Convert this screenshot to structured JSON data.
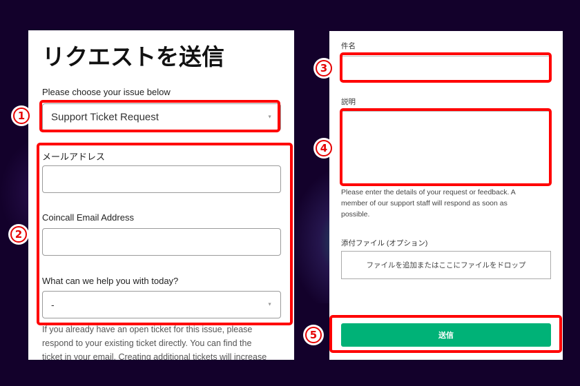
{
  "left_panel": {
    "title": "リクエストを送信",
    "issue_label": "Please choose your issue below",
    "issue_select": {
      "value": "Support Ticket Request"
    },
    "email_label": "メールアドレス",
    "email_input": {
      "value": ""
    },
    "coincall_email_label": "Coincall Email Address",
    "coincall_email_input": {
      "value": ""
    },
    "help_label": "What can we help you with today?",
    "help_select": {
      "value": "-"
    },
    "notice_lines": [
      "If you already have an open ticket for this issue, please",
      "respond to your existing ticket directly. You can find the",
      "ticket in your email. Creating additional tickets will increase"
    ]
  },
  "right_panel": {
    "subject_label": "件名",
    "subject_input": {
      "value": ""
    },
    "description_label": "説明",
    "description_input": {
      "value": ""
    },
    "description_help_lines": [
      "Please enter the details of your request or feedback. A",
      "member of our support staff will respond as soon as",
      "possible."
    ],
    "attachment_label": "添付ファイル (オプション)",
    "attachment_dropzone": "ファイルを追加またはここにファイルをドロップ",
    "submit_label": "送信"
  },
  "annotations": [
    {
      "number": "1",
      "target": "issue-select"
    },
    {
      "number": "2",
      "target": "email-fields-group"
    },
    {
      "number": "3",
      "target": "subject-input"
    },
    {
      "number": "4",
      "target": "description-input"
    },
    {
      "number": "5",
      "target": "submit-button"
    }
  ],
  "colors": {
    "background": "#13012b",
    "highlight": "#ff0000",
    "submit": "#00b277"
  }
}
